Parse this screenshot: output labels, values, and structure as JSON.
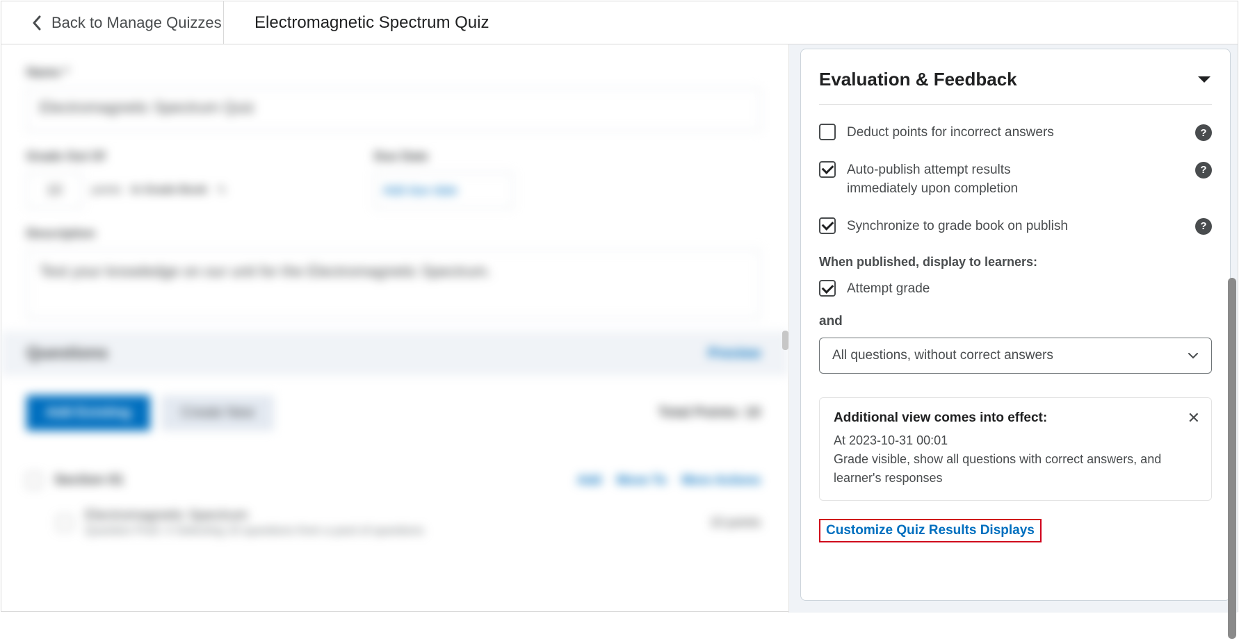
{
  "topbar": {
    "back_label": "Back to Manage Quizzes",
    "page_title": "Electromagnetic Spectrum Quiz"
  },
  "left": {
    "name_label": "Name *",
    "name_value": "Electromagnetic Spectrum Quiz",
    "grade_label": "Grade Out Of",
    "grade_value": "10",
    "grade_unit": "points",
    "in_gradebook": "In Grade Book",
    "due_label": "Due Date",
    "due_value": "Add due date",
    "desc_label": "Description",
    "desc_value": "Test your knowledge on our unit for the Electromagnetic Spectrum.",
    "questions_title": "Questions",
    "preview_label": "Preview",
    "add_existing": "Add Existing",
    "create_new": "Create New",
    "total": "Total Points: 10",
    "section_label": "Section 01",
    "link1": "Add",
    "link2": "Move To",
    "link3": "More Actions",
    "q_title": "Electromagnetic Spectrum",
    "q_sub": "Question Pool: 4 Selecting 10 questions from a pool of questions",
    "q_points": "10 points"
  },
  "panel": {
    "title": "Evaluation & Feedback",
    "opt1": "Deduct points for incorrect answers",
    "opt2": "Auto-publish attempt results immediately upon completion",
    "opt3": "Synchronize to grade book on publish",
    "sublabel": "When published, display to learners:",
    "opt4": "Attempt grade",
    "and": "and",
    "select_value": "All questions, without correct answers",
    "card_title": "Additional view comes into effect:",
    "card_date": "At 2023-10-31 00:01",
    "card_desc": "Grade visible, show all questions with correct answers, and learner's responses",
    "customize": "Customize Quiz Results Displays"
  }
}
